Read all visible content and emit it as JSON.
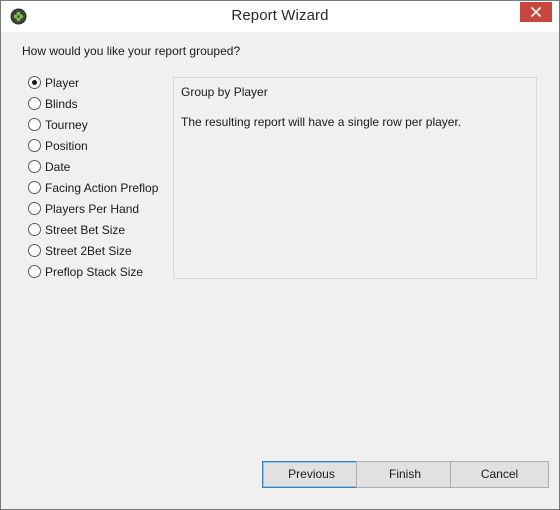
{
  "window": {
    "title": "Report Wizard",
    "app_icon": "gear-clover-icon",
    "close_icon": "close-icon"
  },
  "prompt": "How would you like your report grouped?",
  "group_options": [
    {
      "label": "Player",
      "checked": true
    },
    {
      "label": "Blinds",
      "checked": false
    },
    {
      "label": "Tourney",
      "checked": false
    },
    {
      "label": "Position",
      "checked": false
    },
    {
      "label": "Date",
      "checked": false
    },
    {
      "label": "Facing Action Preflop",
      "checked": false
    },
    {
      "label": "Players Per Hand",
      "checked": false
    },
    {
      "label": "Street Bet Size",
      "checked": false
    },
    {
      "label": "Street 2Bet Size",
      "checked": false
    },
    {
      "label": "Preflop Stack Size",
      "checked": false
    }
  ],
  "description": {
    "title": "Group by Player",
    "body": "The resulting report will have a single row per player."
  },
  "buttons": {
    "previous": "Previous",
    "finish": "Finish",
    "cancel": "Cancel"
  },
  "colors": {
    "close_button": "#c7463d",
    "window_bg": "#f0f0f0",
    "default_button_border": "#3c7fb1",
    "app_icon_green": "#79c340"
  }
}
